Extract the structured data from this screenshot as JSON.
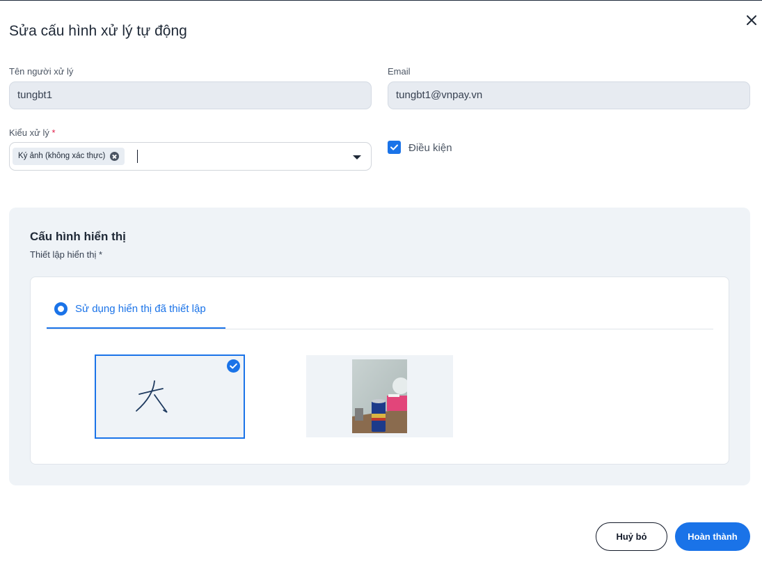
{
  "dialog": {
    "title": "Sửa cấu hình xử lý tự động",
    "close_icon": "close-icon"
  },
  "form": {
    "handler_label": "Tên người xử lý",
    "handler_value": "tungbt1",
    "email_label": "Email",
    "email_value": "tungbt1@vnpay.vn",
    "type_label": "Kiểu xử lý",
    "required_mark": "*",
    "type_selected": [
      "Ký ảnh (không xác thực)"
    ],
    "condition_label": "Điều kiện",
    "condition_checked": true
  },
  "display_config": {
    "title": "Cấu hình hiển thị",
    "subtitle": "Thiết lập hiển thị *",
    "tab_label": "Sử dụng hiển thị đã thiết lập",
    "options": [
      {
        "kind": "signature",
        "selected": true
      },
      {
        "kind": "photo",
        "selected": false
      }
    ]
  },
  "footer": {
    "cancel_label": "Huỷ bỏ",
    "confirm_label": "Hoàn thành"
  },
  "colors": {
    "accent": "#1a73e8",
    "panel_bg": "#eff3f7",
    "required": "#e11d48"
  }
}
